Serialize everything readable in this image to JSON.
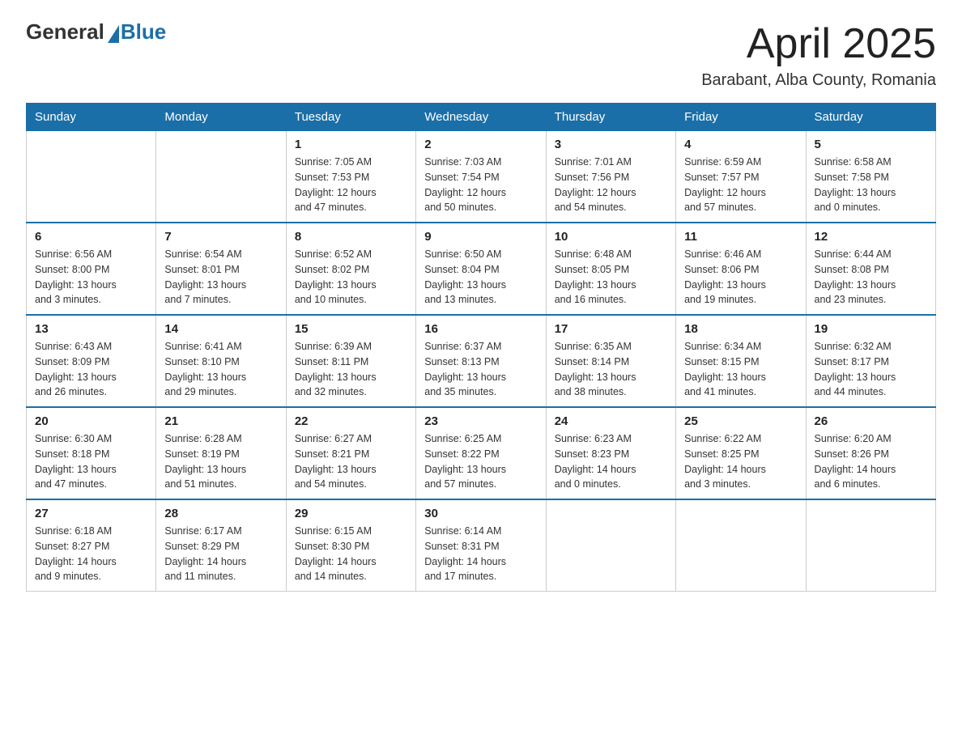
{
  "header": {
    "logo_general": "General",
    "logo_blue": "Blue",
    "month_title": "April 2025",
    "location": "Barabant, Alba County, Romania"
  },
  "weekdays": [
    "Sunday",
    "Monday",
    "Tuesday",
    "Wednesday",
    "Thursday",
    "Friday",
    "Saturday"
  ],
  "weeks": [
    [
      {
        "day": "",
        "info": ""
      },
      {
        "day": "",
        "info": ""
      },
      {
        "day": "1",
        "info": "Sunrise: 7:05 AM\nSunset: 7:53 PM\nDaylight: 12 hours\nand 47 minutes."
      },
      {
        "day": "2",
        "info": "Sunrise: 7:03 AM\nSunset: 7:54 PM\nDaylight: 12 hours\nand 50 minutes."
      },
      {
        "day": "3",
        "info": "Sunrise: 7:01 AM\nSunset: 7:56 PM\nDaylight: 12 hours\nand 54 minutes."
      },
      {
        "day": "4",
        "info": "Sunrise: 6:59 AM\nSunset: 7:57 PM\nDaylight: 12 hours\nand 57 minutes."
      },
      {
        "day": "5",
        "info": "Sunrise: 6:58 AM\nSunset: 7:58 PM\nDaylight: 13 hours\nand 0 minutes."
      }
    ],
    [
      {
        "day": "6",
        "info": "Sunrise: 6:56 AM\nSunset: 8:00 PM\nDaylight: 13 hours\nand 3 minutes."
      },
      {
        "day": "7",
        "info": "Sunrise: 6:54 AM\nSunset: 8:01 PM\nDaylight: 13 hours\nand 7 minutes."
      },
      {
        "day": "8",
        "info": "Sunrise: 6:52 AM\nSunset: 8:02 PM\nDaylight: 13 hours\nand 10 minutes."
      },
      {
        "day": "9",
        "info": "Sunrise: 6:50 AM\nSunset: 8:04 PM\nDaylight: 13 hours\nand 13 minutes."
      },
      {
        "day": "10",
        "info": "Sunrise: 6:48 AM\nSunset: 8:05 PM\nDaylight: 13 hours\nand 16 minutes."
      },
      {
        "day": "11",
        "info": "Sunrise: 6:46 AM\nSunset: 8:06 PM\nDaylight: 13 hours\nand 19 minutes."
      },
      {
        "day": "12",
        "info": "Sunrise: 6:44 AM\nSunset: 8:08 PM\nDaylight: 13 hours\nand 23 minutes."
      }
    ],
    [
      {
        "day": "13",
        "info": "Sunrise: 6:43 AM\nSunset: 8:09 PM\nDaylight: 13 hours\nand 26 minutes."
      },
      {
        "day": "14",
        "info": "Sunrise: 6:41 AM\nSunset: 8:10 PM\nDaylight: 13 hours\nand 29 minutes."
      },
      {
        "day": "15",
        "info": "Sunrise: 6:39 AM\nSunset: 8:11 PM\nDaylight: 13 hours\nand 32 minutes."
      },
      {
        "day": "16",
        "info": "Sunrise: 6:37 AM\nSunset: 8:13 PM\nDaylight: 13 hours\nand 35 minutes."
      },
      {
        "day": "17",
        "info": "Sunrise: 6:35 AM\nSunset: 8:14 PM\nDaylight: 13 hours\nand 38 minutes."
      },
      {
        "day": "18",
        "info": "Sunrise: 6:34 AM\nSunset: 8:15 PM\nDaylight: 13 hours\nand 41 minutes."
      },
      {
        "day": "19",
        "info": "Sunrise: 6:32 AM\nSunset: 8:17 PM\nDaylight: 13 hours\nand 44 minutes."
      }
    ],
    [
      {
        "day": "20",
        "info": "Sunrise: 6:30 AM\nSunset: 8:18 PM\nDaylight: 13 hours\nand 47 minutes."
      },
      {
        "day": "21",
        "info": "Sunrise: 6:28 AM\nSunset: 8:19 PM\nDaylight: 13 hours\nand 51 minutes."
      },
      {
        "day": "22",
        "info": "Sunrise: 6:27 AM\nSunset: 8:21 PM\nDaylight: 13 hours\nand 54 minutes."
      },
      {
        "day": "23",
        "info": "Sunrise: 6:25 AM\nSunset: 8:22 PM\nDaylight: 13 hours\nand 57 minutes."
      },
      {
        "day": "24",
        "info": "Sunrise: 6:23 AM\nSunset: 8:23 PM\nDaylight: 14 hours\nand 0 minutes."
      },
      {
        "day": "25",
        "info": "Sunrise: 6:22 AM\nSunset: 8:25 PM\nDaylight: 14 hours\nand 3 minutes."
      },
      {
        "day": "26",
        "info": "Sunrise: 6:20 AM\nSunset: 8:26 PM\nDaylight: 14 hours\nand 6 minutes."
      }
    ],
    [
      {
        "day": "27",
        "info": "Sunrise: 6:18 AM\nSunset: 8:27 PM\nDaylight: 14 hours\nand 9 minutes."
      },
      {
        "day": "28",
        "info": "Sunrise: 6:17 AM\nSunset: 8:29 PM\nDaylight: 14 hours\nand 11 minutes."
      },
      {
        "day": "29",
        "info": "Sunrise: 6:15 AM\nSunset: 8:30 PM\nDaylight: 14 hours\nand 14 minutes."
      },
      {
        "day": "30",
        "info": "Sunrise: 6:14 AM\nSunset: 8:31 PM\nDaylight: 14 hours\nand 17 minutes."
      },
      {
        "day": "",
        "info": ""
      },
      {
        "day": "",
        "info": ""
      },
      {
        "day": "",
        "info": ""
      }
    ]
  ]
}
